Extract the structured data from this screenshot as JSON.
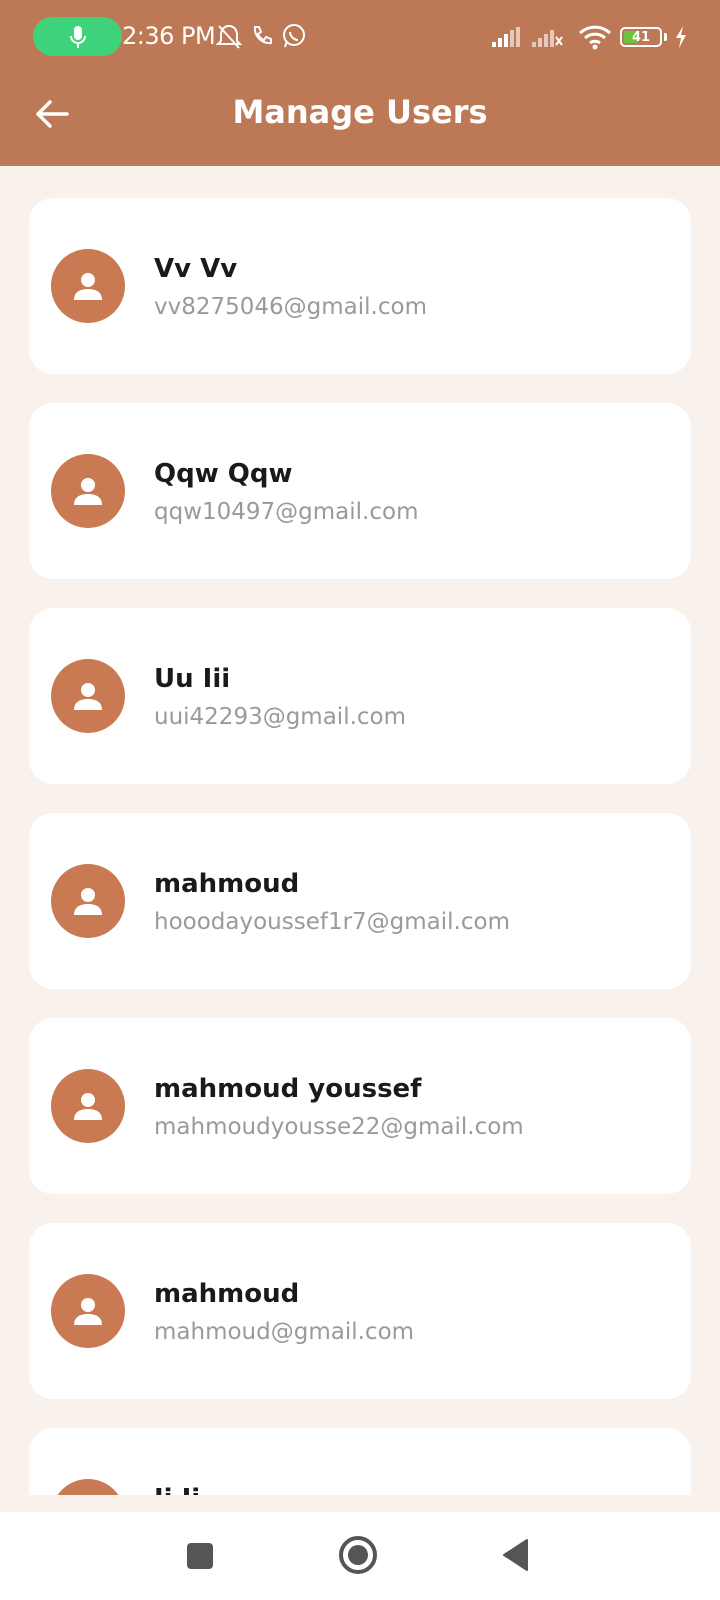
{
  "status_bar": {
    "time": "2:36 PM",
    "battery_level": 41,
    "battery_text": "41",
    "icons": [
      "mic-icon",
      "bell-off-icon",
      "phone-icon",
      "whatsapp-icon",
      "signal-icon",
      "signal-no-service-icon",
      "wifi-icon",
      "battery-icon",
      "charging-icon"
    ]
  },
  "header": {
    "title": "Manage Users",
    "back_icon": "arrow-left-icon"
  },
  "users": [
    {
      "name": "Vv Vv",
      "email": "vv8275046@gmail.com"
    },
    {
      "name": "Qqw Qqw",
      "email": "qqw10497@gmail.com"
    },
    {
      "name": "Uu Iii",
      "email": "uui42293@gmail.com"
    },
    {
      "name": "mahmoud",
      "email": "hooodayoussef1r7@gmail.com"
    },
    {
      "name": "mahmoud youssef",
      "email": "mahmoudyousse22@gmail.com"
    },
    {
      "name": "mahmoud",
      "email": "mahmoud@gmail.com"
    },
    {
      "name": "Ii Ii",
      "email": ""
    }
  ],
  "colors": {
    "app_bar": "#bd7855",
    "avatar": "#c97a52",
    "background": "#f8f1ec",
    "mic_pill": "#3ed27a"
  },
  "nav_bar": {
    "icons": [
      "recents-square-icon",
      "home-circle-icon",
      "back-triangle-icon"
    ]
  }
}
